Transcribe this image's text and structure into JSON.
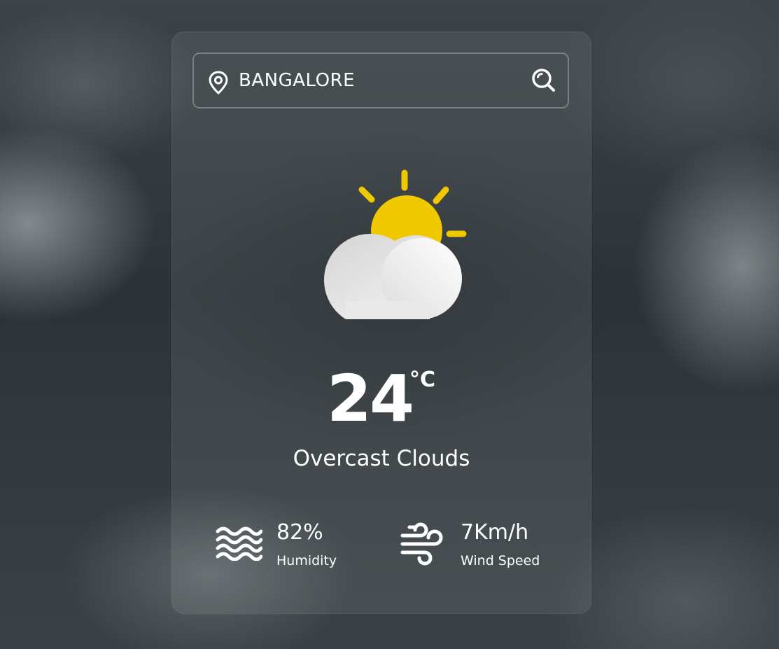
{
  "search": {
    "value": "Bangalore",
    "location_icon": "location-pin-icon",
    "button_icon": "search-icon"
  },
  "weather": {
    "icon": "partly-cloudy-icon",
    "temperature": "24",
    "unit": "°C",
    "description": "Overcast Clouds"
  },
  "details": {
    "humidity": {
      "value": "82%",
      "label": "Humidity",
      "icon": "humidity-waves-icon"
    },
    "wind": {
      "value": "7Km/h",
      "label": "Wind Speed",
      "icon": "wind-icon"
    }
  },
  "colors": {
    "sun": "#f0c800",
    "cloud": "#ececec",
    "text": "#ffffff"
  }
}
